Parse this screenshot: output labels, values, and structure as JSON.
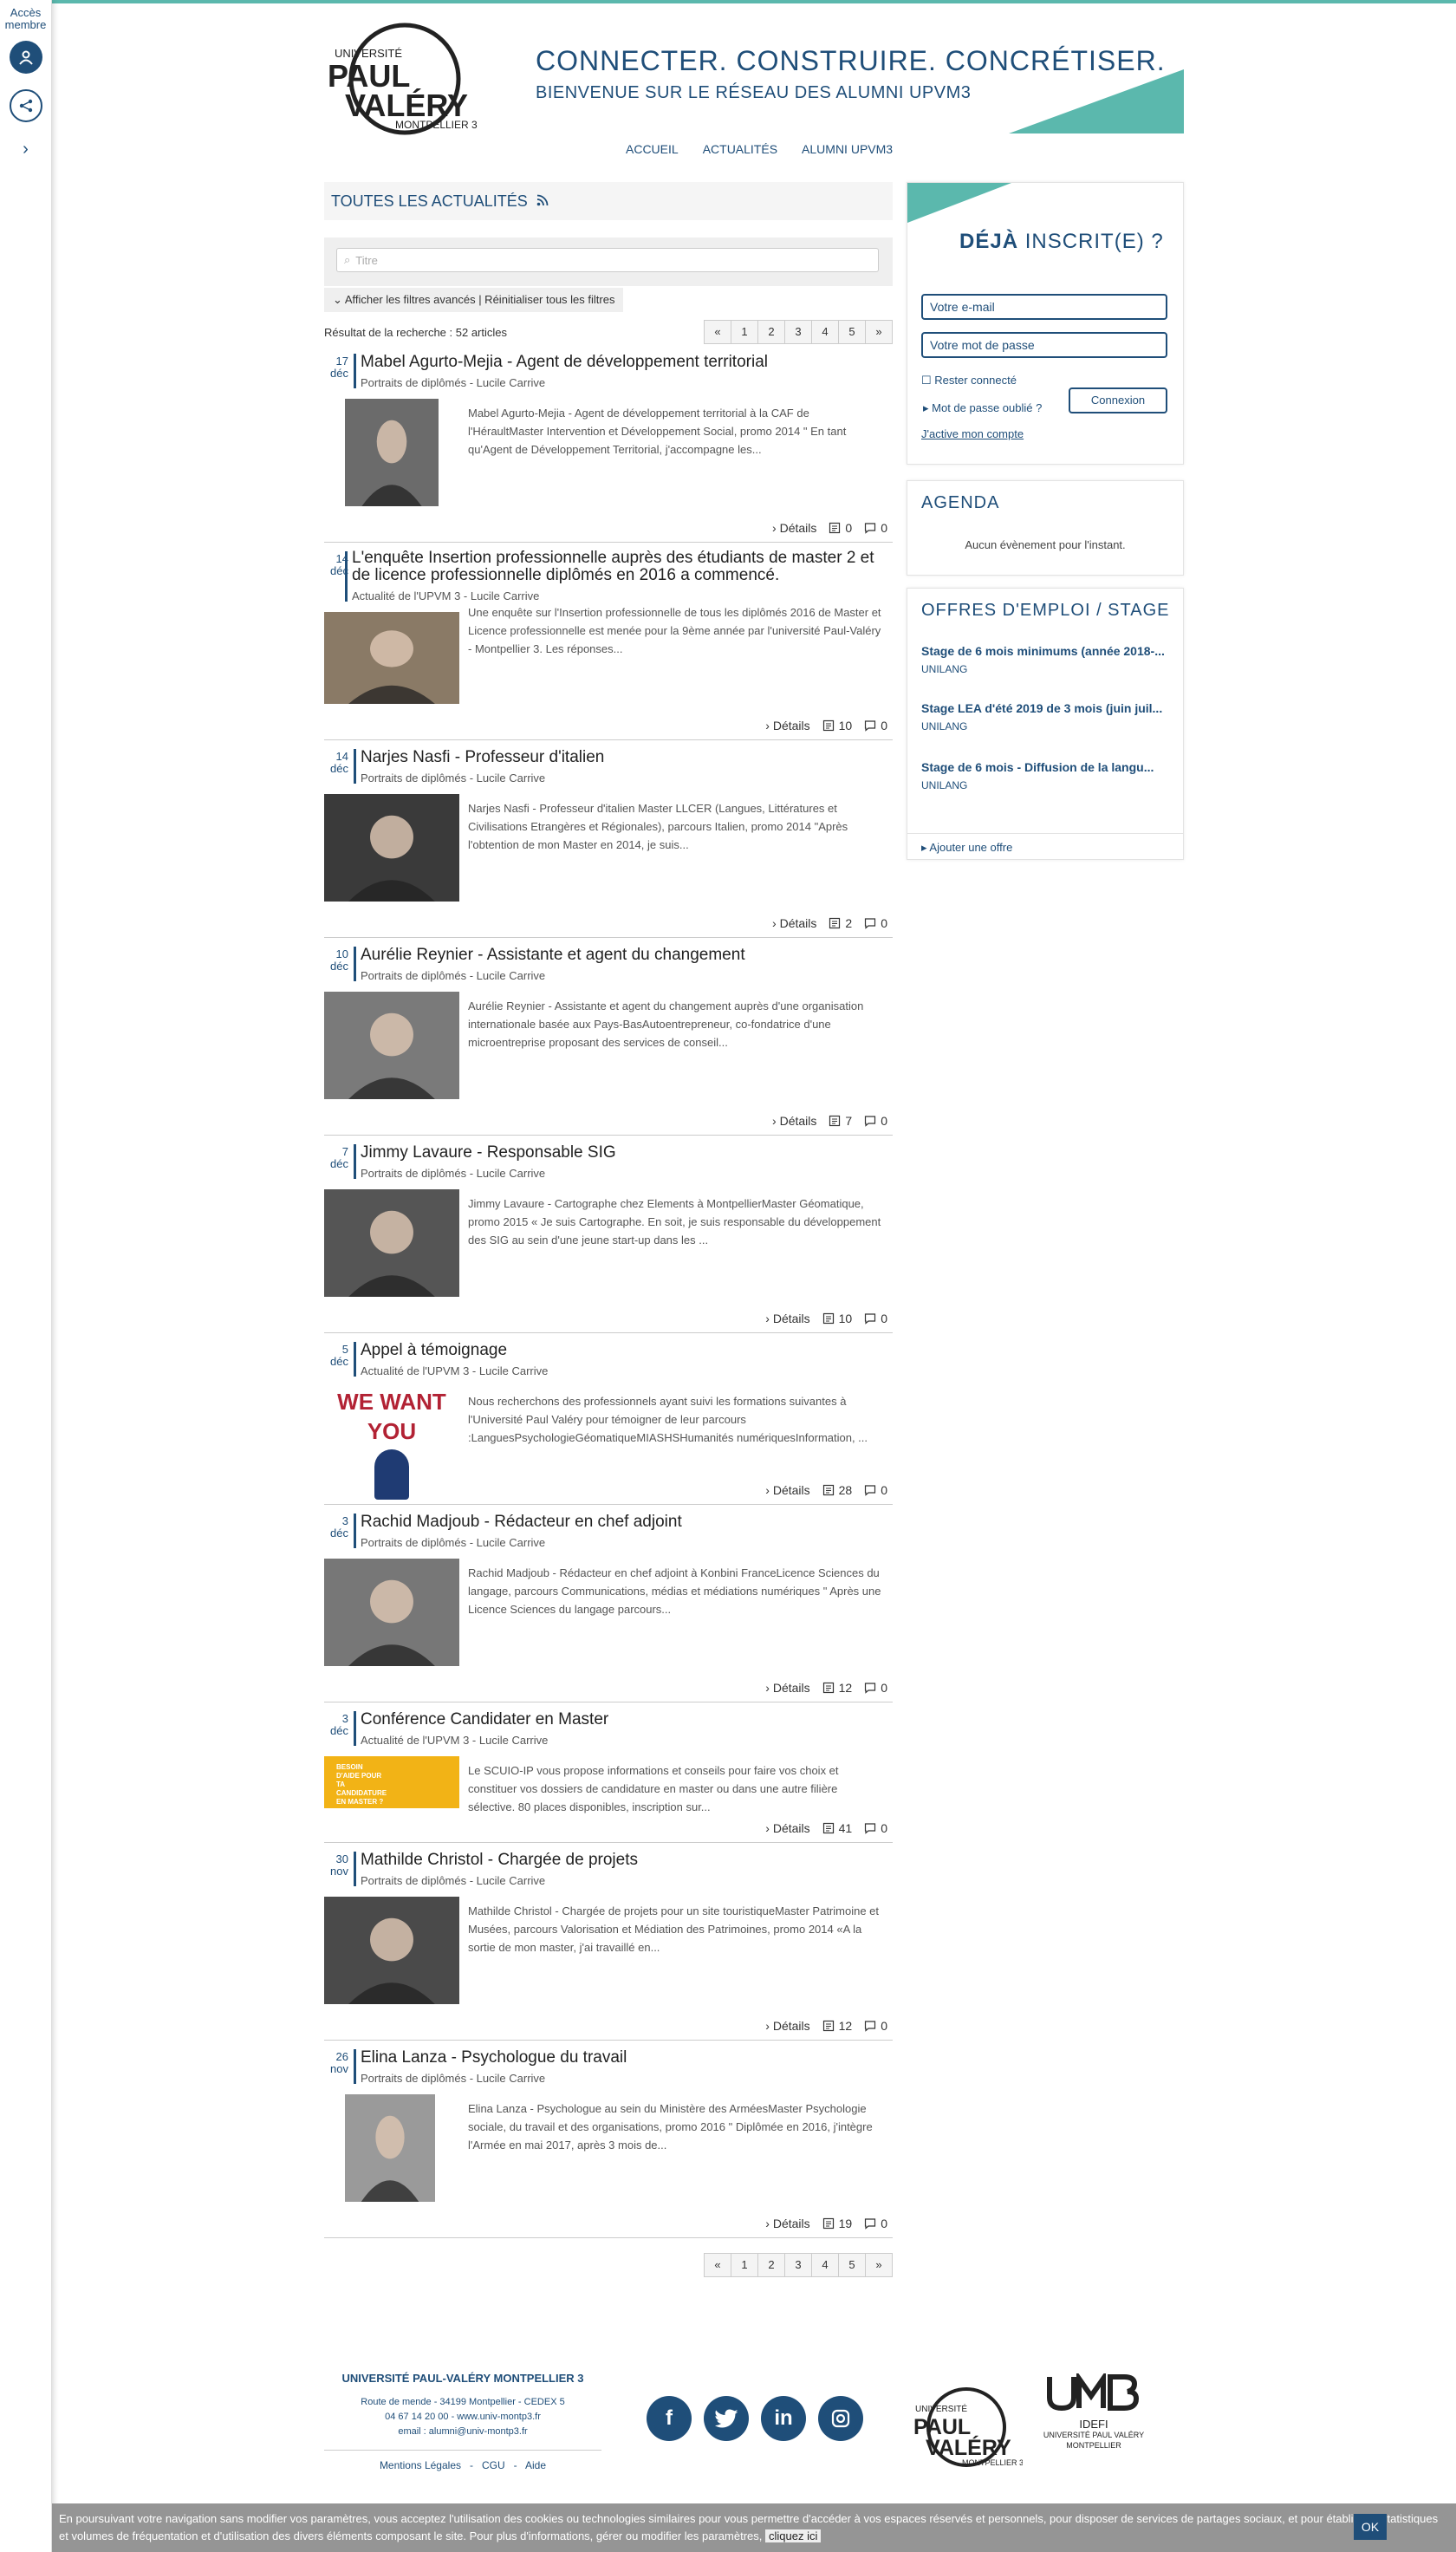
{
  "rail": {
    "acces_label": "Accès membre"
  },
  "header": {
    "logo_text": [
      "UNIVERSITÉ",
      "PAUL",
      "VALÉRY",
      "MONTPELLIER 3"
    ],
    "tagline": "CONNECTER. CONSTRUIRE. CONCRÉTISER.",
    "subtitle": "BIENVENUE SUR LE RÉSEAU DES ALUMNI UPVM3",
    "accent_color": "#5bb8ad",
    "brand_color": "#1f4e79"
  },
  "nav": [
    "ACCUEIL",
    "ACTUALITÉS",
    "ALUMNI UPVM3"
  ],
  "news": {
    "heading": "TOUTES LES ACTUALITÉS",
    "search_placeholder": "Titre",
    "advanced_filters": "Afficher les filtres avancés | Réinitialiser tous les filtres",
    "result_text": "Résultat de la recherche : 52 articles",
    "pager": [
      "«",
      "1",
      "2",
      "3",
      "4",
      "5",
      "»"
    ],
    "details_label": "Détails",
    "articles": [
      {
        "day": "17",
        "month": "déc",
        "title": "Mabel Agurto-Mejia - Agent de développement territorial",
        "category": "Portraits de diplômés - Lucile Carrive",
        "excerpt": "Mabel Agurto-Mejia - Agent de développement territorial à la CAF de l'HéraultMaster Intervention et Développement Social, promo 2014 \" En tant qu'Agent de Développement Territorial, j'accompagne les...",
        "views": "0",
        "comments": "0"
      },
      {
        "day": "14",
        "month": "déc",
        "title": "L'enquête Insertion professionnelle auprès des étudiants de master 2 et de licence professionnelle diplômés en 2016 a commencé.",
        "category": "Actualité de l'UPVM 3 - Lucile Carrive",
        "excerpt": "Une enquête sur l'Insertion professionnelle de tous les diplômés 2016 de Master et Licence professionnelle est menée pour la 9ème année par l'université Paul-Valéry - Montpellier 3. Les réponses...",
        "views": "10",
        "comments": "0"
      },
      {
        "day": "14",
        "month": "déc",
        "title": "Narjes Nasfi - Professeur d'italien",
        "category": "Portraits de diplômés - Lucile Carrive",
        "excerpt": "Narjes Nasfi - Professeur d'italien Master LLCER (Langues, Littératures et Civilisations Etrangères et Régionales), parcours Italien, promo 2014 \"Après l'obtention de mon Master en 2014, je suis...",
        "views": "2",
        "comments": "0"
      },
      {
        "day": "10",
        "month": "déc",
        "title": "Aurélie Reynier - Assistante et agent du changement",
        "category": "Portraits de diplômés - Lucile Carrive",
        "excerpt": "Aurélie Reynier - Assistante et agent du changement auprès d'une organisation internationale basée aux Pays-BasAutoentrepreneur, co-fondatrice d'une microentreprise proposant des services de conseil...",
        "views": "7",
        "comments": "0"
      },
      {
        "day": "7",
        "month": "déc",
        "title": "Jimmy Lavaure - Responsable SIG",
        "category": "Portraits de diplômés - Lucile Carrive",
        "excerpt": "Jimmy Lavaure - Cartographe chez Elements à MontpellierMaster Géomatique, promo 2015 « Je suis Cartographe. En soit, je suis responsable du développement des SIG au sein d'une jeune start-up dans les ...",
        "views": "10",
        "comments": "0"
      },
      {
        "day": "5",
        "month": "déc",
        "title": "Appel à témoignage",
        "category": "Actualité de l'UPVM 3 - Lucile Carrive",
        "excerpt": "Nous recherchons des professionnels ayant suivi les formations suivantes à l'Université Paul Valéry pour témoigner de leur parcours :LanguesPsychologieGéomatiqueMIASHSHumanités numériquesInformation, ...",
        "views": "28",
        "comments": "0",
        "image_text": "WE WANT YOU"
      },
      {
        "day": "3",
        "month": "déc",
        "title": "Rachid Madjoub - Rédacteur en chef adjoint",
        "category": "Portraits de diplômés - Lucile Carrive",
        "excerpt": "Rachid Madjoub - Rédacteur en chef adjoint à Konbini FranceLicence Sciences du langage, parcours Communications, médias et médiations numériques \" Après une Licence Sciences du langage parcours...",
        "views": "12",
        "comments": "0"
      },
      {
        "day": "3",
        "month": "déc",
        "title": "Conférence Candidater en Master",
        "category": "Actualité de l'UPVM 3 - Lucile Carrive",
        "excerpt": "Le SCUIO-IP vous propose informations et conseils pour faire vos choix et constituer vos dossiers de candidature en master ou dans une autre filière sélective. 80 places disponibles, inscription sur...",
        "views": "41",
        "comments": "0",
        "image_text": "BESOIN D'AIDE POUR TA CANDIDATURE EN MASTER ?"
      },
      {
        "day": "30",
        "month": "nov",
        "title": "Mathilde Christol - Chargée de projets",
        "category": "Portraits de diplômés - Lucile Carrive",
        "excerpt": "Mathilde Christol - Chargée de projets pour un site touristiqueMaster Patrimoine et Musées, parcours Valorisation et Médiation des Patrimoines, promo 2014 «A la sortie de mon master, j'ai travaillé en...",
        "views": "12",
        "comments": "0"
      },
      {
        "day": "26",
        "month": "nov",
        "title": "Elina Lanza - Psychologue du travail",
        "category": "Portraits de diplômés - Lucile Carrive",
        "excerpt": "Elina Lanza - Psychologue au sein du Ministère des ArméesMaster Psychologie sociale, du travail et des organisations, promo 2016 \" Diplômée en 2016, j'intègre l'Armée en mai 2017, après 3 mois de...",
        "views": "19",
        "comments": "0"
      }
    ]
  },
  "login": {
    "heading_bold": "DÉJÀ",
    "heading_rest": " INSCRIT(E) ?",
    "email_placeholder": "Votre e-mail",
    "password_placeholder": "Votre mot de passe",
    "remember": "Rester connecté",
    "forgot": "Mot de passe oublié ?",
    "connect": "Connexion",
    "activate": "J'active mon compte"
  },
  "agenda": {
    "heading": "AGENDA",
    "empty": "Aucun évènement pour l'instant."
  },
  "jobs": {
    "heading": "OFFRES D'EMPLOI / STAGE",
    "items": [
      {
        "title": "Stage de 6 mois minimums (année 2018-...",
        "company": "UNILANG"
      },
      {
        "title": "Stage LEA d'été 2019 de 3 mois (juin juil...",
        "company": "UNILANG"
      },
      {
        "title": "Stage de 6 mois - Diffusion de la langu...",
        "company": "UNILANG"
      }
    ],
    "add": "Ajouter une offre"
  },
  "footer": {
    "university": "UNIVERSITÉ PAUL-VALÉRY MONTPELLIER 3",
    "address": "Route de mende - 34199 Montpellier - CEDEX 5",
    "phone": "04 67 14 20 00 - www.univ-montp3.fr",
    "email": "email : alumni@univ-montp3.fr",
    "links": [
      "Mentions Légales",
      "CGU",
      "Aide"
    ],
    "umb_labels": [
      "IDEFI",
      "UNIVERSITÉ PAUL VALÉRY",
      "MONTPELLIER"
    ]
  },
  "cookie": {
    "text": "En poursuivant votre navigation sans modifier vos paramètres, vous acceptez l'utilisation des cookies ou technologies similaires pour vous permettre d'accéder à vos espaces réservés et personnels, pour disposer de services de partages sociaux, et pour établir des statistiques et volumes de fréquentation et d'utilisation des divers éléments composant le site. Pour plus d'informations, gérer ou modifier les paramètres,",
    "link": "cliquez ici",
    "ok": "OK"
  }
}
